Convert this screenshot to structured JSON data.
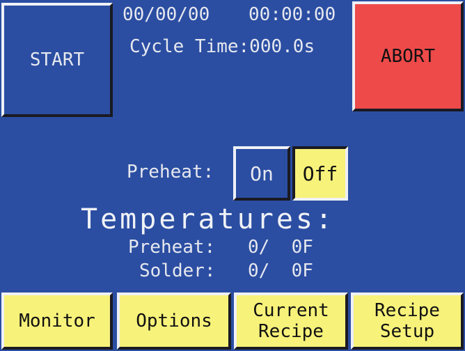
{
  "header": {
    "date": "00/00/00",
    "time": "00:00:00",
    "cycle_time": "Cycle Time:000.0s"
  },
  "buttons": {
    "start": "START",
    "abort": "ABORT"
  },
  "preheat_toggle": {
    "label": "Preheat:",
    "on": "On",
    "off": "Off",
    "selected": "Off"
  },
  "temperatures": {
    "heading": "Temperatures:",
    "rows": [
      {
        "label": "Preheat:",
        "value": "0/  0F"
      },
      {
        "label": "Solder:",
        "value": "0/  0F"
      }
    ]
  },
  "tabs": {
    "monitor": "Monitor",
    "options": "Options",
    "current_recipe_line1": "Current",
    "current_recipe_line2": "Recipe",
    "recipe_setup_line1": "Recipe",
    "recipe_setup_line2": "Setup"
  },
  "colors": {
    "background": "#2b4ea2",
    "abort": "#ee4a4a",
    "highlight": "#f7f27a"
  }
}
